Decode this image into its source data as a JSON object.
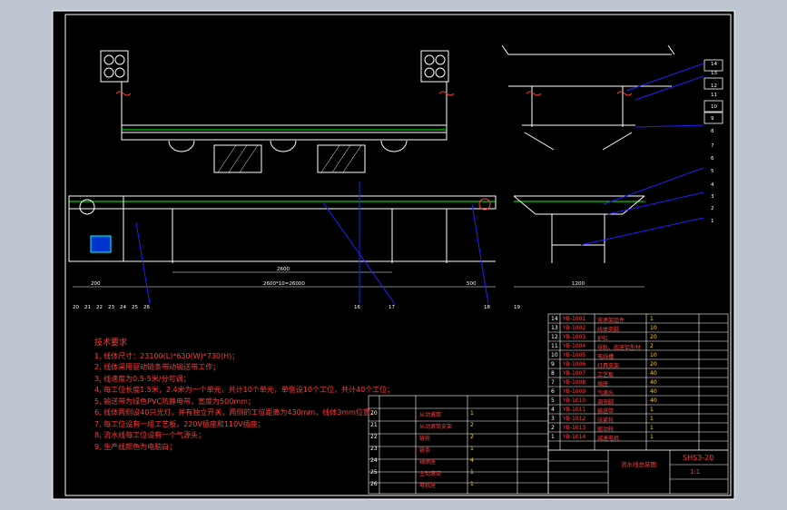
{
  "drawing": {
    "part_numbers_right": [
      "14",
      "13",
      "12",
      "11",
      "10",
      "9",
      "8",
      "7",
      "6",
      "5",
      "4",
      "3",
      "2",
      "1"
    ],
    "part_numbers_left": [
      "20",
      "21",
      "22",
      "23",
      "24",
      "25",
      "26"
    ],
    "part_numbers_bottom": [
      "16",
      "17",
      "18",
      "19"
    ],
    "dims": {
      "main_span": "2600",
      "total_length": "2600*10=26000",
      "left_end": "200",
      "right_end": "500",
      "width": "1200"
    },
    "tech_notes": {
      "title": "技术要求",
      "items": [
        "1, 线体尺寸：23100(L)*630(W)*730(H)；",
        "2, 线体采用驱动链条带动输送带工作；",
        "3, 线速度为0.5-5米/分可调；",
        "4, 每工位长度1.5米，2.4米为一个单元，共计10个单元，单侧设10个工位，共计40个工位；",
        "5, 输送带为绿色PVC防静电带，宽度为500mm；",
        "6, 线体两侧设40只光灯，并有独立开关，两侧的工位距离为430mm，线体3mm位置；",
        "7, 每工位设有一组工艺板，220V插座和110V插座；",
        "8, 流水线每工位设有一个气源头；",
        "9, 生产线颜色为电脑白；"
      ]
    },
    "title_block": {
      "drawing_no": "SHS3-20",
      "scale": "1:1",
      "title": "流水线总装图"
    },
    "bom_upper": [
      {
        "no": "14",
        "code": "YB-1001",
        "name": "支承架组件",
        "note": "1"
      },
      {
        "no": "13",
        "code": "YB-1002",
        "name": "线体支脚",
        "note": "10"
      },
      {
        "no": "12",
        "code": "YB-1003",
        "name": "护栏",
        "note": "20"
      },
      {
        "no": "11",
        "code": "YB-1004",
        "name": "导轨、底座铝型材",
        "note": "2"
      },
      {
        "no": "10",
        "code": "YB-1005",
        "name": "电线槽",
        "note": "10"
      },
      {
        "no": "9",
        "code": "YB-1006",
        "name": "灯具支架",
        "note": "20"
      },
      {
        "no": "8",
        "code": "YB-1007",
        "name": "工艺板",
        "note": "40"
      },
      {
        "no": "7",
        "code": "YB-1008",
        "name": "插座",
        "note": "40"
      },
      {
        "no": "6",
        "code": "YB-1009",
        "name": "气源头",
        "note": "40"
      },
      {
        "no": "5",
        "code": "YB-1010",
        "name": "调节脚",
        "note": "40"
      },
      {
        "no": "4",
        "code": "YB-1011",
        "name": "输送带",
        "note": "1"
      },
      {
        "no": "3",
        "code": "YB-1012",
        "name": "张紧轮",
        "note": "1"
      },
      {
        "no": "2",
        "code": "YB-1013",
        "name": "驱动轮",
        "note": "1"
      },
      {
        "no": "1",
        "code": "YB-1014",
        "name": "减速电机",
        "note": "1"
      }
    ],
    "bom_lower": [
      {
        "no": "20",
        "name": "从动滚筒",
        "qty": "1"
      },
      {
        "no": "21",
        "name": "从动滚筒支架",
        "qty": "2"
      },
      {
        "no": "22",
        "name": "链轮",
        "qty": "2"
      },
      {
        "no": "23",
        "name": "链条",
        "qty": "1"
      },
      {
        "no": "24",
        "name": "轴承座",
        "qty": "4"
      },
      {
        "no": "25",
        "name": "主动滚筒",
        "qty": "1"
      },
      {
        "no": "26",
        "name": "电机座",
        "qty": "1"
      }
    ]
  }
}
